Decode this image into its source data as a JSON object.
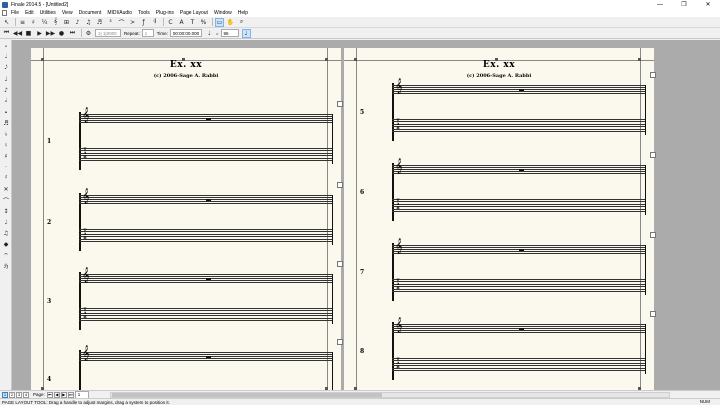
{
  "window": {
    "title": "Finale 2014.5 - [Untitled2]",
    "controls": [
      "—",
      "❐",
      "✕"
    ]
  },
  "menubar": {
    "items": [
      "File",
      "Edit",
      "Utilities",
      "View",
      "Document",
      "MIDI/Audio",
      "Tools",
      "Plug-ins",
      "Page Layout",
      "Window",
      "Help"
    ]
  },
  "toolbar": {
    "tools": [
      {
        "name": "selection-tool-icon",
        "glyph": "↖"
      },
      {
        "name": "staff-tool-icon",
        "glyph": "≡"
      },
      {
        "name": "key-signature-tool-icon",
        "glyph": "♯"
      },
      {
        "name": "time-signature-tool-icon",
        "glyph": "¼"
      },
      {
        "name": "clef-tool-icon",
        "glyph": "𝄞"
      },
      {
        "name": "measure-tool-icon",
        "glyph": "⊞"
      },
      {
        "name": "simple-entry-tool-icon",
        "glyph": "♪"
      },
      {
        "name": "speedy-entry-tool-icon",
        "glyph": "♫"
      },
      {
        "name": "hyperscribe-tool-icon",
        "glyph": "♬"
      },
      {
        "name": "tuplet-tool-icon",
        "glyph": "³"
      },
      {
        "name": "smart-shape-tool-icon",
        "glyph": "⌒"
      },
      {
        "name": "articulation-tool-icon",
        "glyph": ">"
      },
      {
        "name": "expression-tool-icon",
        "glyph": "ƒ"
      },
      {
        "name": "repeat-tool-icon",
        "glyph": "𝄇"
      },
      {
        "name": "chord-tool-icon",
        "glyph": "C"
      },
      {
        "name": "lyrics-tool-icon",
        "glyph": "A"
      },
      {
        "name": "text-tool-icon",
        "glyph": "T"
      },
      {
        "name": "resize-tool-icon",
        "glyph": "%"
      },
      {
        "name": "page-layout-tool-icon",
        "glyph": "▭"
      },
      {
        "name": "hand-grabber-icon",
        "glyph": "✋"
      },
      {
        "name": "zoom-tool-icon",
        "glyph": "⌕"
      }
    ],
    "playback": {
      "counter_value": "1| 1|0000",
      "repeat_label": "Repeat:",
      "repeat_value": "1",
      "time_label": "Time:",
      "time_value": "00:00:00.000",
      "tempo_value": "96"
    }
  },
  "palette": {
    "tools": [
      "𝅗",
      "𝅘𝅥",
      "𝅘𝅥𝅮",
      "♩",
      "♪",
      "𝅗𝅥",
      "𝅝",
      "♬",
      "♭",
      "♮",
      "♯",
      "·",
      "𝄽",
      "✕",
      "⌒",
      "↕",
      "♩",
      "♫",
      "◆",
      "𝄐",
      "ℌ"
    ]
  },
  "score": {
    "title": "Ex. xx",
    "subtitle": "(c) 2006-Sage A. Rabbi",
    "page1_systems": [
      "1",
      "2",
      "3",
      "4"
    ],
    "page2_systems": [
      "5",
      "6",
      "7",
      "8"
    ]
  },
  "statusbar": {
    "page_buttons": [
      "1",
      "2",
      "3",
      "4"
    ],
    "page_label": "Page:",
    "page_value": "1",
    "message": "PAGE LAYOUT TOOL: Drag a handle to adjust margins, drag a system to position it.",
    "num_indicator": "NUM"
  }
}
